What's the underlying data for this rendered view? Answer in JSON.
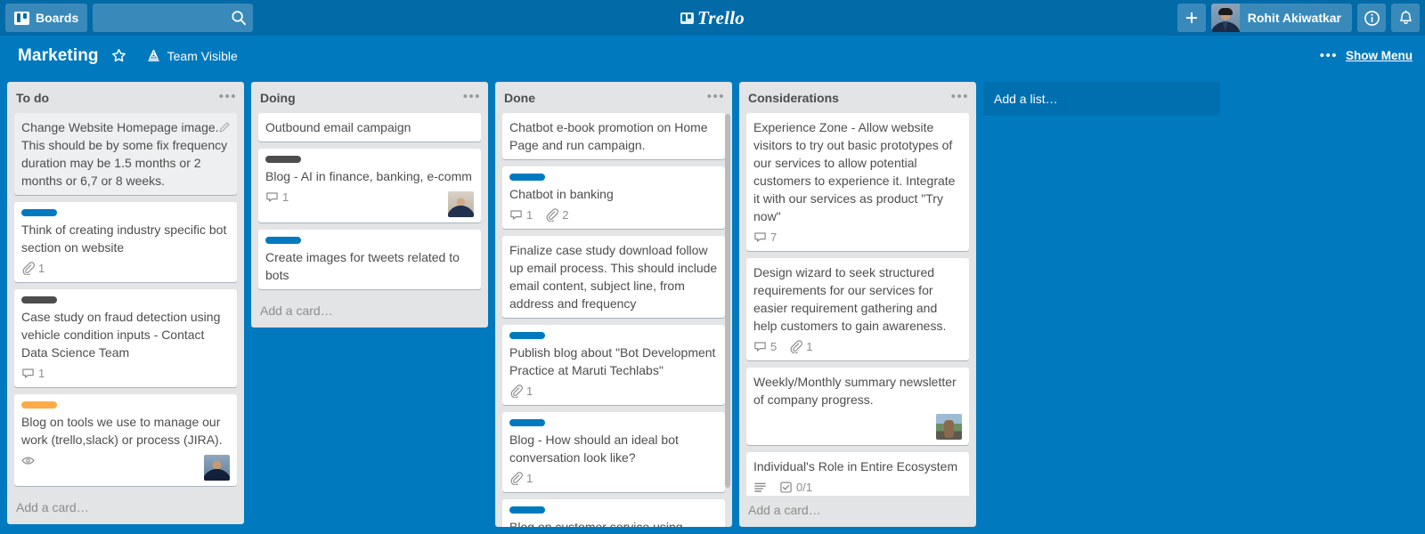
{
  "header": {
    "boards_button": "Boards",
    "search_placeholder": "",
    "search_value": "",
    "logo_text": "Trello",
    "add_button": "+",
    "member_name": "Rohit Akiwatkar",
    "info_icon": "info-circle-icon",
    "notifications_icon": "bell-icon",
    "search_icon": "search-icon",
    "boards_icon": "board-grid-icon"
  },
  "board_header": {
    "title": "Marketing",
    "star_icon": "star-icon",
    "visibility_icon": "team-visible-icon",
    "visibility_label": "Team Visible",
    "menu_dots": "•••",
    "show_menu": "Show Menu"
  },
  "colors": {
    "topbar": "#026AA7",
    "board_bg": "#0079BF",
    "list_bg": "#E2E4E6",
    "card_bg": "#FFFFFF",
    "label_blue": "#0079BF",
    "label_black": "#4D4D4D",
    "label_orange": "#FFAB4A"
  },
  "add_list": {
    "label": "Add a list…"
  },
  "lists": [
    {
      "title": "To do",
      "menu": "•••",
      "add_card": "Add a card…",
      "selected": false,
      "scrollbar": false,
      "cards": [
        {
          "title": "Change Website Homepage image. This should be by some fix frequency duration may be 1.5 months or 2 months or 6,7 or 8 weeks.",
          "label": null,
          "hovered": true,
          "edit_icon": "pencil-edit-icon",
          "badges": [],
          "members": []
        },
        {
          "title": "Think of creating industry specific bot section on website",
          "label": "label_blue",
          "badges": [
            {
              "icon": "attachment-icon",
              "value": "1"
            }
          ],
          "members": []
        },
        {
          "title": "Case study on fraud detection using vehicle condition inputs - Contact Data Science Team",
          "label": "label_black",
          "badges": [
            {
              "icon": "comment-icon",
              "value": "1"
            }
          ],
          "members": []
        },
        {
          "title": "Blog on tools we use to manage our work (trello,slack) or process (JIRA).",
          "label": "label_orange",
          "badges": [
            {
              "icon": "watch-eye-icon",
              "value": ""
            }
          ],
          "members": [
            "member-avatar-male"
          ]
        }
      ]
    },
    {
      "title": "Doing",
      "menu": "•••",
      "add_card": "Add a card…",
      "selected": false,
      "scrollbar": false,
      "cards": [
        {
          "title": "Outbound email campaign",
          "label": null,
          "badges": [],
          "members": []
        },
        {
          "title": "Blog - AI in finance, banking, e-comm",
          "label": "label_black",
          "badges": [
            {
              "icon": "comment-icon",
              "value": "1"
            }
          ],
          "members": [
            "member-avatar-female"
          ]
        },
        {
          "title": "Create images for tweets related to bots",
          "label": "label_blue",
          "badges": [],
          "members": []
        }
      ]
    },
    {
      "title": "Done",
      "menu": "•••",
      "add_card": "",
      "selected": false,
      "scrollbar": true,
      "cards": [
        {
          "title": "Chatbot e-book promotion on Home Page and run campaign.",
          "label": null,
          "badges": [],
          "members": []
        },
        {
          "title": "Chatbot in banking",
          "label": "label_blue",
          "badges": [
            {
              "icon": "comment-icon",
              "value": "1"
            },
            {
              "icon": "attachment-icon",
              "value": "2"
            }
          ],
          "members": []
        },
        {
          "title": "Finalize case study download follow up email process. This should include email content, subject line, from address and frequency",
          "label": null,
          "badges": [],
          "members": []
        },
        {
          "title": "Publish blog about \"Bot Development Practice at Maruti Techlabs\"",
          "label": "label_blue",
          "badges": [
            {
              "icon": "attachment-icon",
              "value": "1"
            }
          ],
          "members": []
        },
        {
          "title": "Blog - How should an ideal bot conversation look like?",
          "label": "label_blue",
          "badges": [
            {
              "icon": "attachment-icon",
              "value": "1"
            }
          ],
          "members": []
        },
        {
          "title": "Blog on customer service using",
          "label": "label_blue",
          "badges": [],
          "members": []
        }
      ]
    },
    {
      "title": "Considerations",
      "menu": "•••",
      "add_card": "Add a card…",
      "selected": true,
      "scrollbar": false,
      "cards": [
        {
          "title": "Experience Zone - Allow website visitors to try out basic prototypes of our services to allow potential customers to experience it. Integrate it with our services as product \"Try now\"",
          "label": null,
          "badges": [
            {
              "icon": "comment-icon",
              "value": "7"
            }
          ],
          "members": []
        },
        {
          "title": "Design wizard to seek structured requirements for our services for easier requirement gathering and help customers to gain awareness.",
          "label": null,
          "badges": [
            {
              "icon": "comment-icon",
              "value": "5"
            },
            {
              "icon": "attachment-icon",
              "value": "1"
            }
          ],
          "members": []
        },
        {
          "title": "Weekly/Monthly summary newsletter of company progress.",
          "label": null,
          "badges": [],
          "members": [
            "member-avatar-outdoor"
          ]
        },
        {
          "title": "Individual's Role in Entire Ecosystem",
          "label": null,
          "badges": [
            {
              "icon": "description-icon",
              "value": ""
            },
            {
              "icon": "checklist-icon",
              "value": "0/1"
            }
          ],
          "members": []
        }
      ]
    }
  ]
}
